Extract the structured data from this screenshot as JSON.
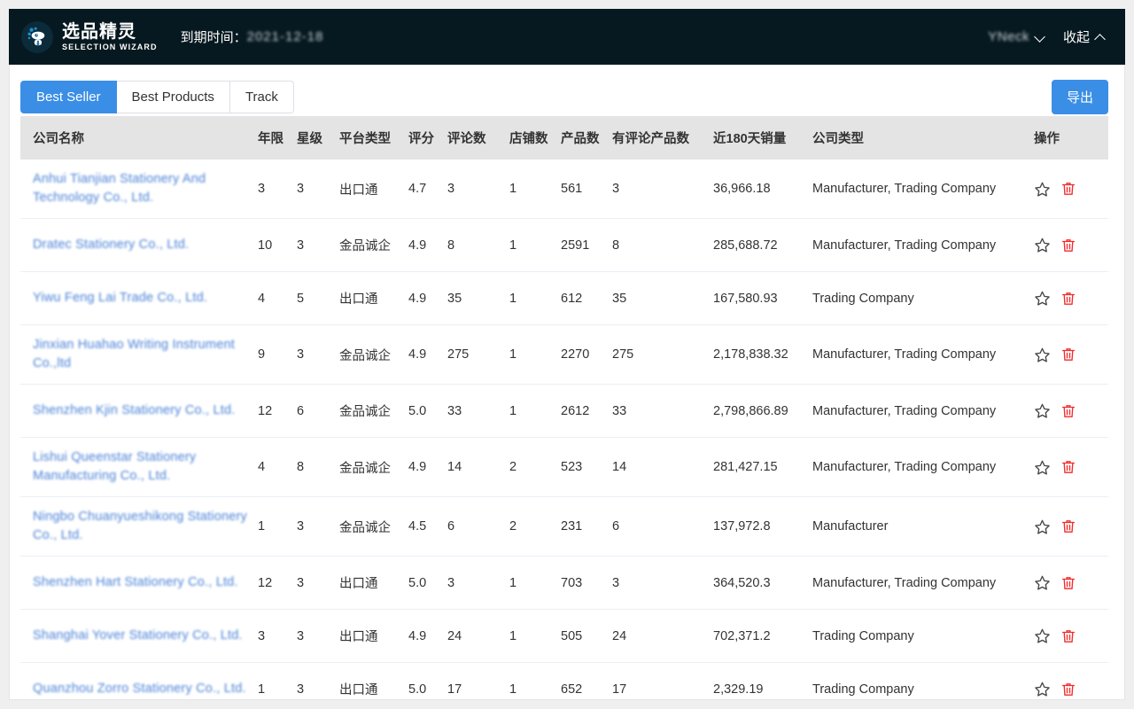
{
  "header": {
    "brand_cn": "选品精灵",
    "brand_en": "SELECTION WIZARD",
    "logo_icon": "robot-mascot-icon",
    "expiry_label": "到期时间：",
    "expiry_value": "2021-12-18",
    "username": "YNeck",
    "user_chevron_icon": "chevron-down-icon",
    "collapse_label": "收起",
    "collapse_chevron_icon": "chevron-up-icon"
  },
  "toolbar": {
    "tabs": [
      {
        "label": "Best Seller",
        "active": true
      },
      {
        "label": "Best Products",
        "active": false
      },
      {
        "label": "Track",
        "active": false
      }
    ],
    "export_label": "导出"
  },
  "table": {
    "columns": [
      "公司名称",
      "年限",
      "星级",
      "平台类型",
      "评分",
      "评论数",
      "店铺数",
      "产品数",
      "有评论产品数",
      "近180天销量",
      "公司类型",
      "操作"
    ],
    "row_actions": {
      "favorite_icon": "star-icon",
      "delete_icon": "trash-icon",
      "favorite_color": "#444444",
      "delete_color": "#f22b2b"
    },
    "rows": [
      {
        "company": "Anhui Tianjian Stationery And Technology Co., Ltd.",
        "years": "3",
        "stars": "3",
        "platform": "出口通",
        "score": "4.7",
        "reviews": "3",
        "shops": "1",
        "products": "561",
        "reviewed_products": "3",
        "sales_180d": "36,966.18",
        "company_type": "Manufacturer, Trading Company"
      },
      {
        "company": "Dratec Stationery Co., Ltd.",
        "years": "10",
        "stars": "3",
        "platform": "金品诚企",
        "score": "4.9",
        "reviews": "8",
        "shops": "1",
        "products": "2591",
        "reviewed_products": "8",
        "sales_180d": "285,688.72",
        "company_type": "Manufacturer, Trading Company"
      },
      {
        "company": "Yiwu Feng Lai Trade Co., Ltd.",
        "years": "4",
        "stars": "5",
        "platform": "出口通",
        "score": "4.9",
        "reviews": "35",
        "shops": "1",
        "products": "612",
        "reviewed_products": "35",
        "sales_180d": "167,580.93",
        "company_type": "Trading Company"
      },
      {
        "company": "Jinxian Huahao Writing Instrument Co.,ltd",
        "years": "9",
        "stars": "3",
        "platform": "金品诚企",
        "score": "4.9",
        "reviews": "275",
        "shops": "1",
        "products": "2270",
        "reviewed_products": "275",
        "sales_180d": "2,178,838.32",
        "company_type": "Manufacturer, Trading Company"
      },
      {
        "company": "Shenzhen Kjin Stationery Co., Ltd.",
        "years": "12",
        "stars": "6",
        "platform": "金品诚企",
        "score": "5.0",
        "reviews": "33",
        "shops": "1",
        "products": "2612",
        "reviewed_products": "33",
        "sales_180d": "2,798,866.89",
        "company_type": "Manufacturer, Trading Company"
      },
      {
        "company": "Lishui Queenstar Stationery Manufacturing Co., Ltd.",
        "years": "4",
        "stars": "8",
        "platform": "金品诚企",
        "score": "4.9",
        "reviews": "14",
        "shops": "2",
        "products": "523",
        "reviewed_products": "14",
        "sales_180d": "281,427.15",
        "company_type": "Manufacturer, Trading Company"
      },
      {
        "company": "Ningbo Chuanyueshikong Stationery Co., Ltd.",
        "years": "1",
        "stars": "3",
        "platform": "金品诚企",
        "score": "4.5",
        "reviews": "6",
        "shops": "2",
        "products": "231",
        "reviewed_products": "6",
        "sales_180d": "137,972.8",
        "company_type": "Manufacturer"
      },
      {
        "company": "Shenzhen Hart Stationery Co., Ltd.",
        "years": "12",
        "stars": "3",
        "platform": "出口通",
        "score": "5.0",
        "reviews": "3",
        "shops": "1",
        "products": "703",
        "reviewed_products": "3",
        "sales_180d": "364,520.3",
        "company_type": "Manufacturer, Trading Company"
      },
      {
        "company": "Shanghai Yover Stationery Co., Ltd.",
        "years": "3",
        "stars": "3",
        "platform": "出口通",
        "score": "4.9",
        "reviews": "24",
        "shops": "1",
        "products": "505",
        "reviewed_products": "24",
        "sales_180d": "702,371.2",
        "company_type": "Trading Company"
      },
      {
        "company": "Quanzhou Zorro Stationery Co., Ltd.",
        "years": "1",
        "stars": "3",
        "platform": "出口通",
        "score": "5.0",
        "reviews": "17",
        "shops": "1",
        "products": "652",
        "reviewed_products": "17",
        "sales_180d": "2,329.19",
        "company_type": "Trading Company"
      }
    ]
  },
  "colors": {
    "header_bg": "#071920",
    "accent": "#3a8ee6",
    "link": "#4a82d8",
    "danger": "#f22b2b",
    "table_header_bg": "#e4e4e4"
  }
}
